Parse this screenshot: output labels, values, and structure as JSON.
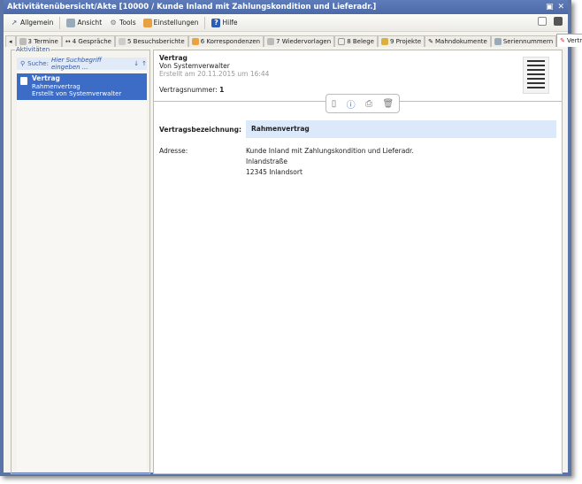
{
  "window": {
    "title": "Aktivitätenübersicht/Akte [10000 / Kunde Inland mit Zahlungskondition und Lieferadr.]"
  },
  "toolbar": {
    "items": [
      {
        "label": "Allgemein",
        "icon": "arrow-icon"
      },
      {
        "label": "Ansicht",
        "icon": "view-icon"
      },
      {
        "label": "Tools",
        "icon": "gear-icon"
      },
      {
        "label": "Einstellungen",
        "icon": "settings-icon"
      },
      {
        "label": "Hilfe",
        "icon": "help-icon"
      }
    ]
  },
  "tabs": [
    {
      "label": "3 Termine"
    },
    {
      "label": "4 Gespräche"
    },
    {
      "label": "5 Besuchsberichte"
    },
    {
      "label": "6 Korrespondenzen"
    },
    {
      "label": "7 Wiedervorlagen"
    },
    {
      "label": "8 Belege"
    },
    {
      "label": "9 Projekte"
    },
    {
      "label": "Mahndokumente"
    },
    {
      "label": "Seriennummern"
    },
    {
      "label": "Verträge",
      "active": true
    }
  ],
  "left": {
    "group_label": "Aktivitäten",
    "search_label": "Suche:",
    "search_placeholder": "Hier Suchbegriff eingeben ...",
    "item": {
      "title": "Vertrag",
      "line1": "Rahmenvertrag",
      "line2": "Erstellt von Systemverwalter"
    }
  },
  "detail": {
    "title": "Vertrag",
    "by": "Von Systemverwalter",
    "created": "Erstellt am 20.11.2015 um 16:44",
    "number_label": "Vertragsnummer:",
    "number": "1",
    "designation_label": "Vertragsbezeichnung:",
    "designation": "Rahmenvertrag",
    "address_label": "Adresse:",
    "address": [
      "Kunde Inland mit Zahlungskondition und Lieferadr.",
      "Inlandstraße",
      "12345 Inlandsort"
    ]
  },
  "colors": {
    "accent": "#3c6cc6",
    "frame": "#5a74a8",
    "highlight": "#dce9fa"
  }
}
